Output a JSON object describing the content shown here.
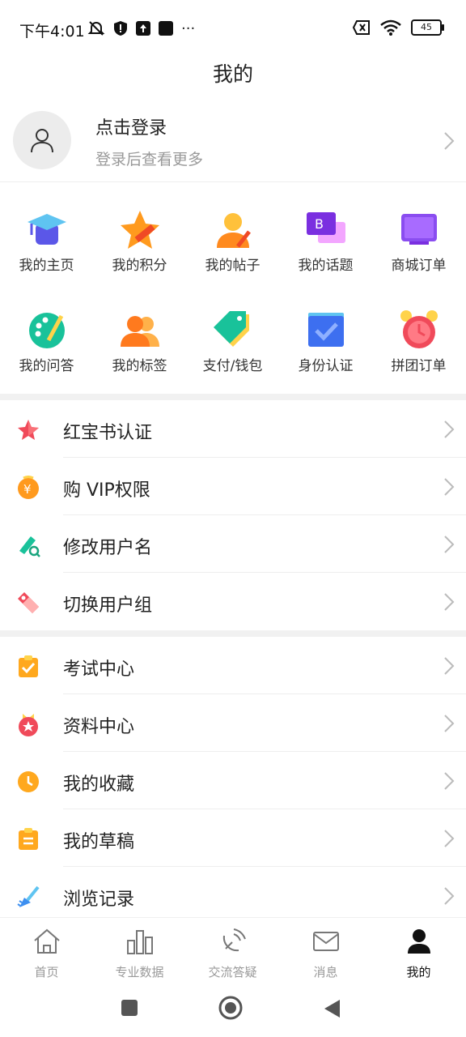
{
  "status": {
    "time": "下午4:01",
    "battery": "45",
    "more": "···"
  },
  "header": {
    "title": "我的"
  },
  "profile": {
    "login": "点击登录",
    "subtitle": "登录后查看更多"
  },
  "grid": [
    {
      "label": "我的主页",
      "icon": "graduation-cap-icon"
    },
    {
      "label": "我的积分",
      "icon": "star-icon"
    },
    {
      "label": "我的帖子",
      "icon": "person-edit-icon"
    },
    {
      "label": "我的话题",
      "icon": "chat-bubbles-icon"
    },
    {
      "label": "商城订单",
      "icon": "tv-icon"
    },
    {
      "label": "我的问答",
      "icon": "palette-icon"
    },
    {
      "label": "我的标签",
      "icon": "people-icon"
    },
    {
      "label": "支付/钱包",
      "icon": "price-tag-icon"
    },
    {
      "label": "身份认证",
      "icon": "checkbox-icon"
    },
    {
      "label": "拼团订单",
      "icon": "alarm-clock-icon"
    }
  ],
  "list1": [
    {
      "label": "红宝书认证",
      "icon": "red-star-icon"
    },
    {
      "label": "购 VIP权限",
      "icon": "yuan-coin-icon"
    },
    {
      "label": "修改用户名",
      "icon": "edit-search-icon"
    },
    {
      "label": "切换用户组",
      "icon": "tag-icon"
    }
  ],
  "list2": [
    {
      "label": "考试中心",
      "icon": "clipboard-check-icon"
    },
    {
      "label": "资料中心",
      "icon": "badge-star-icon"
    },
    {
      "label": "我的收藏",
      "icon": "clock-icon"
    },
    {
      "label": "我的草稿",
      "icon": "clipboard-lines-icon"
    },
    {
      "label": "浏览记录",
      "icon": "broom-icon"
    }
  ],
  "tabs": [
    {
      "label": "首页",
      "icon": "home-icon"
    },
    {
      "label": "专业数据",
      "icon": "bar-chart-icon"
    },
    {
      "label": "交流答疑",
      "icon": "satellite-icon"
    },
    {
      "label": "消息",
      "icon": "mail-icon"
    },
    {
      "label": "我的",
      "icon": "person-icon"
    }
  ],
  "colors": {
    "accent": "#111111",
    "inactive": "#999999",
    "separator": "#f1f1f1"
  }
}
